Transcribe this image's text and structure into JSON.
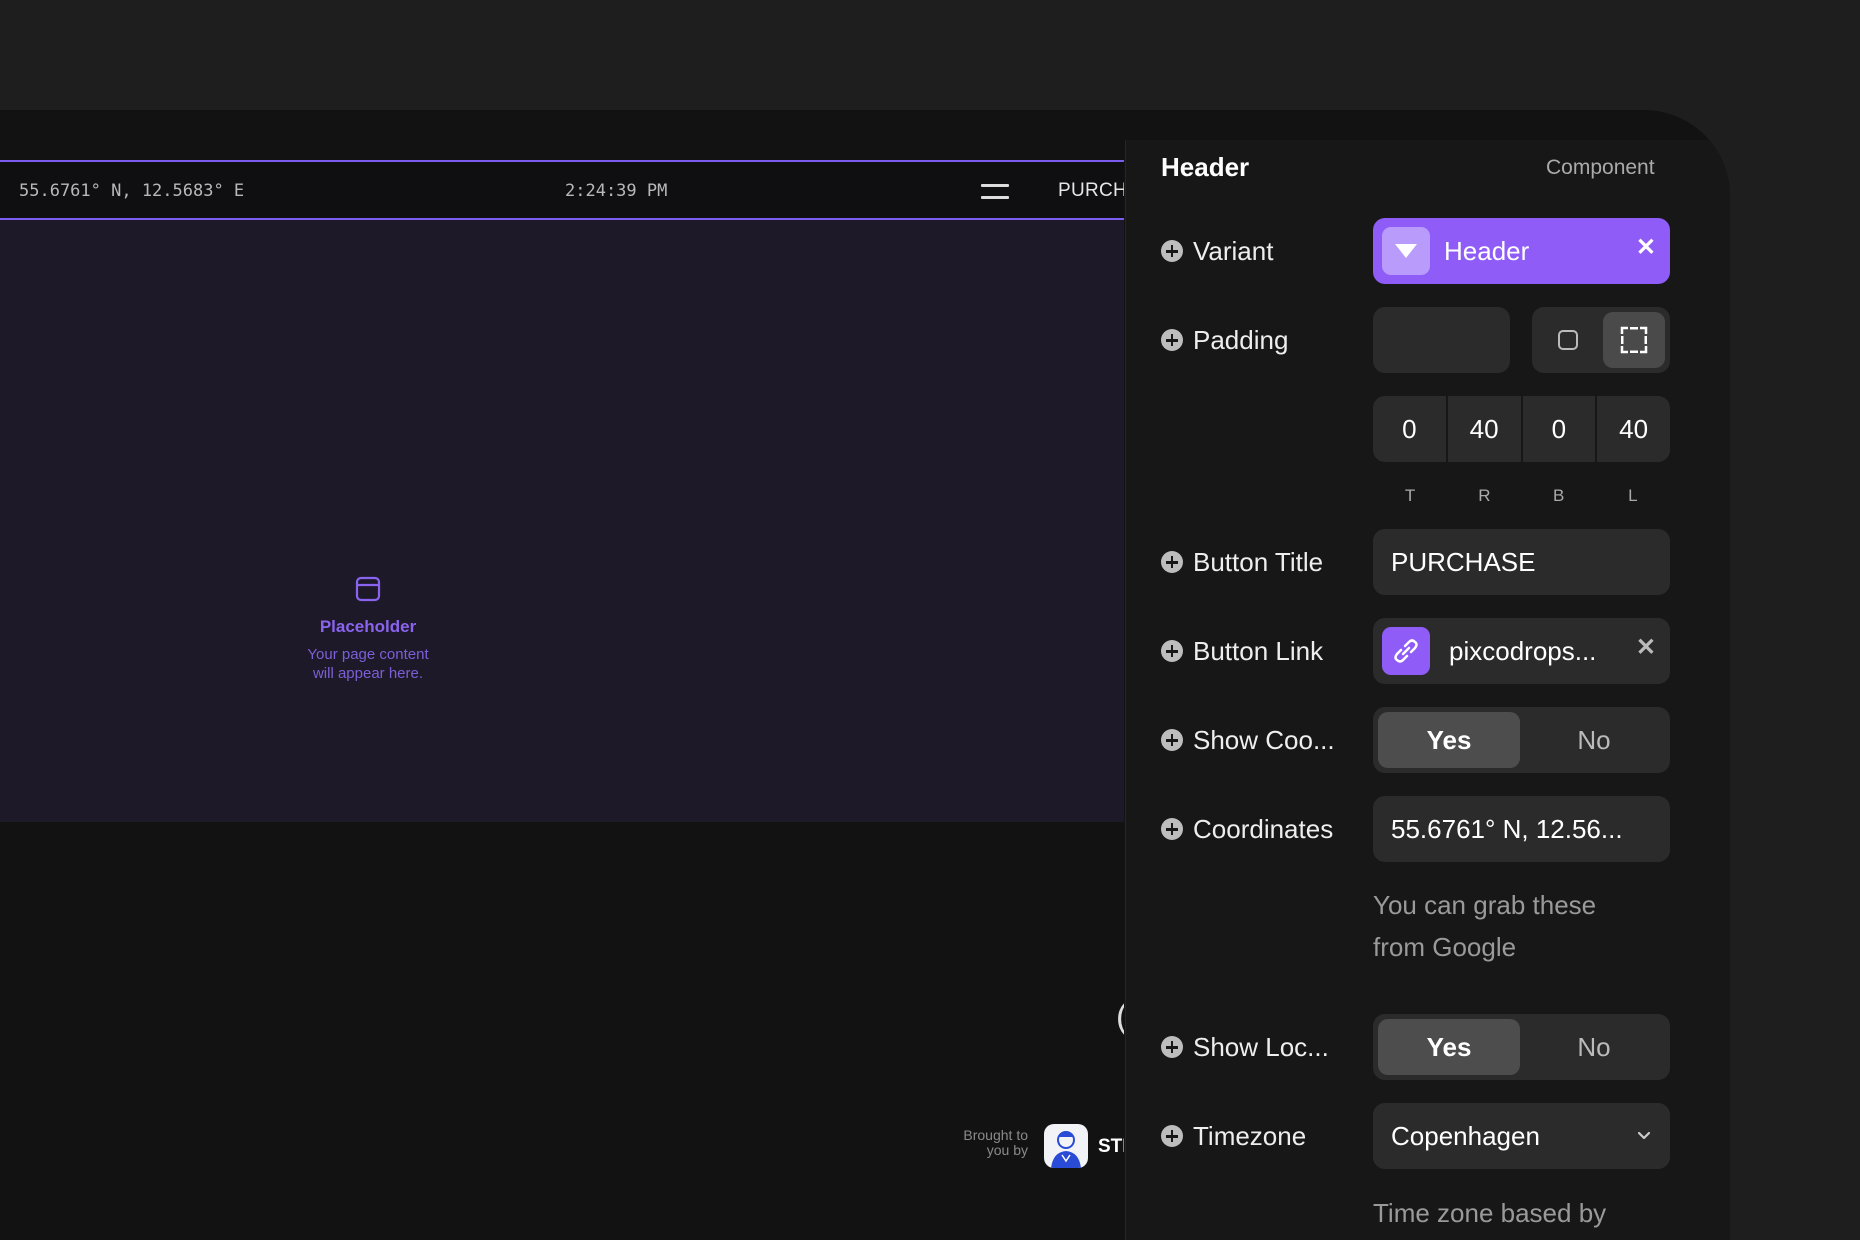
{
  "preview": {
    "coordinates": "55.6761° N, 12.5683° E",
    "clock": "2:24:39 PM",
    "button_text": "PURCH",
    "placeholder_title": "Placeholder",
    "placeholder_line1": "Your page content",
    "placeholder_line2": "will appear here.",
    "paren": "(",
    "brought_line1": "Brought to",
    "brought_line2": "you by",
    "brand_text": "STI"
  },
  "panel": {
    "title": "Header",
    "kind": "Component",
    "variant": {
      "label": "Variant",
      "value": "Header"
    },
    "padding": {
      "label": "Padding",
      "values": [
        "0",
        "40",
        "0",
        "40"
      ],
      "sides": [
        "T",
        "R",
        "B",
        "L"
      ]
    },
    "button_title": {
      "label": "Button Title",
      "value": "PURCHASE"
    },
    "button_link": {
      "label": "Button Link",
      "value": "pixcodrops..."
    },
    "show_coordinates": {
      "label": "Show Coo...",
      "on": "Yes",
      "off": "No"
    },
    "coordinates": {
      "label": "Coordinates",
      "value": "55.6761° N, 12.56...",
      "hint_line1": "You can grab these",
      "hint_line2": "from Google"
    },
    "show_location": {
      "label": "Show Loc...",
      "on": "Yes",
      "off": "No"
    },
    "timezone": {
      "label": "Timezone",
      "value": "Copenhagen",
      "hint": "Time zone based by"
    }
  },
  "colors": {
    "accent": "#8f5cf7",
    "preview_bg": "#1d1929",
    "panel_bg": "#171717"
  },
  "icons": [
    "menu-icon",
    "window-icon",
    "triangle-down-icon",
    "close-icon",
    "link-icon",
    "padding-uniform-icon",
    "padding-individual-icon",
    "chevron-down-icon",
    "plus-circle-icon"
  ]
}
